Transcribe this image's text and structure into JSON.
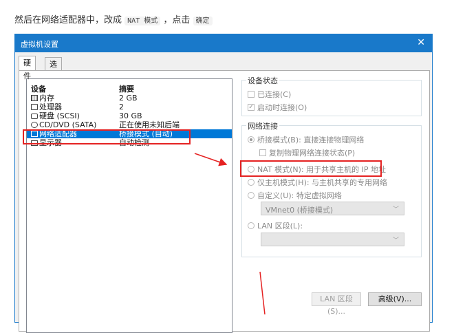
{
  "intro": {
    "text": "然后在网络适配器中，改成",
    "code1": "NAT 模式",
    "mid": "，点击",
    "code2": "确定"
  },
  "dialog": {
    "title": "虚拟机设置",
    "close_glyph": "✕",
    "tabs": [
      {
        "label": "硬件"
      },
      {
        "label": "选项"
      }
    ],
    "device_list": {
      "headers": {
        "device": "设备",
        "summary": "摘要"
      },
      "rows": [
        {
          "icon": "memory-icon",
          "device": "内存",
          "summary": "2 GB"
        },
        {
          "icon": "processor-icon",
          "device": "处理器",
          "summary": "2"
        },
        {
          "icon": "hard-disk-icon",
          "device": "硬盘 (SCSI)",
          "summary": "30 GB"
        },
        {
          "icon": "cd-dvd-icon",
          "device": "CD/DVD (SATA)",
          "summary": "正在使用未知后端"
        },
        {
          "icon": "network-adapter-icon",
          "device": "网络适配器",
          "summary": "桥接模式 (自动)"
        },
        {
          "icon": "display-icon",
          "device": "显示器",
          "summary": "自动检测"
        }
      ]
    },
    "device_status": {
      "label": "设备状态",
      "connected": "已连接(C)",
      "connect_at_power_on": "启动时连接(O)"
    },
    "network_connection": {
      "label": "网络连接",
      "bridged": "桥接模式(B): 直接连接物理网络",
      "replicate": "复制物理网络连接状态(P)",
      "nat": "NAT 模式(N): 用于共享主机的 IP 地址",
      "host_only": "仅主机模式(H): 与主机共享的专用网络",
      "custom": "自定义(U): 特定虚拟网络",
      "custom_select_value": "VMnet0 (桥接模式)",
      "lan_segment": "LAN 区段(L):",
      "lan_select_value": "",
      "chevron": "﹀",
      "lan_segments_button": "LAN 区段(S)...",
      "advanced_button": "高级(V)..."
    },
    "checks": {
      "connected": false,
      "connect_at_power_on": true,
      "replicate": false
    },
    "selected_radio": "bridged"
  },
  "annotation": {
    "color": "#e52222"
  }
}
